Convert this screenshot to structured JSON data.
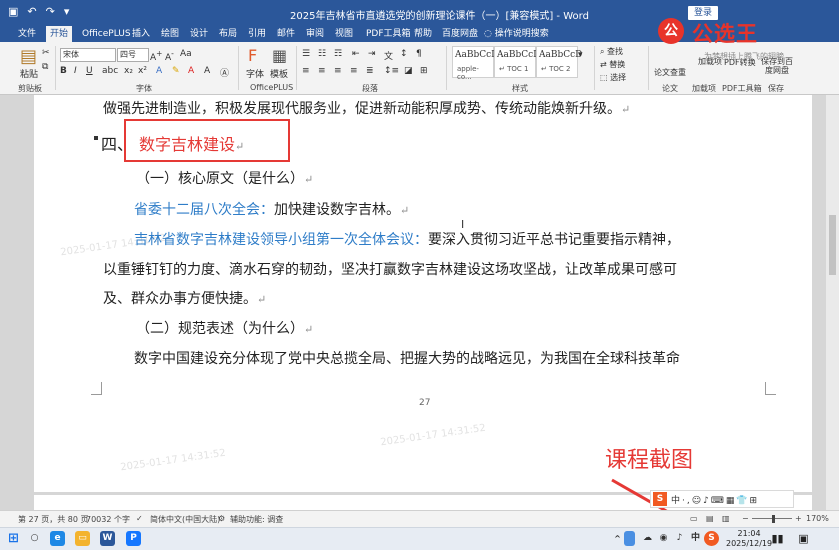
{
  "window": {
    "title": "2025年吉林省市直遴选党的创新理论课件（一）[兼容模式] - Word",
    "login_label": "登录"
  },
  "tabs": [
    "文件",
    "开始",
    "OfficePLUS",
    "插入",
    "绘图",
    "设计",
    "布局",
    "引用",
    "邮件",
    "审阅",
    "视图",
    "PDF工具箱",
    "帮助",
    "百度网盘",
    "操作说明搜索"
  ],
  "ribbon": {
    "paste_label": "粘贴",
    "font_name": "宋体",
    "font_size": "四号",
    "font_btn_label": "字体",
    "template_btn_label": "模板",
    "styles": [
      {
        "sample": "AaBbCcI",
        "name": "apple-co..."
      },
      {
        "sample": "AaBbCcD",
        "name": "↵ TOC 1"
      },
      {
        "sample": "AaBbCcD",
        "name": "↵ TOC 2"
      }
    ],
    "find_label": "查找",
    "replace_label": "替换",
    "select_label": "选择",
    "paper_check_label": "论文查重",
    "addin_label": "加载项",
    "pdf_convert_label": "PDF转换",
    "save_baidu_label": "保存到百度网盘",
    "groups": [
      "剪贴板",
      "字体",
      "OfficePLUS",
      "段落",
      "样式",
      "论文",
      "加载项",
      "PDF工具箱",
      "保存"
    ]
  },
  "logo": {
    "brand": "公选王",
    "slogan": "为梦想插上腾飞的翅膀"
  },
  "document": {
    "line_intro": "做强先进制造业，积极发展现代服务业，促进新动能积厚成势、传统动能焕新升级。",
    "heading_num": "四、",
    "heading": "数字吉林建设",
    "sub1": "（一）核心原文（是什么）",
    "p1_label": "省委十二届八次全会：",
    "p1_text": "加快建设数字吉林。",
    "p2_label": "吉林省数字吉林建设领导小组第一次全体会议：",
    "p2_text_1": "要深入贯彻习近平总书记重要指示精神，",
    "p2_text_2": "以重锤钉钉的力度、滴水石穿的韧劲，坚决打赢数字吉林建设这场攻坚战，让改革成果可感可",
    "p2_text_3": "及、群众办事方便快捷。",
    "sub2": "（二）规范表述（为什么）",
    "p3": "数字中国建设充分体现了党中央总揽全局、把握大势的战略远见，为我国在全球科技革命",
    "page_number": "27",
    "para_mark": "↵"
  },
  "watermarks": [
    "2025-01-17 14:31:52",
    "2025-01-17 14:31:52",
    "2025-01-17 14:31:52"
  ],
  "annotation": "课程截图",
  "statusbar": {
    "page": "第 27 页，共 80 页",
    "words": "70032 个字",
    "language": "简体中文(中国大陆)",
    "accessibility": "辅助功能: 调查",
    "zoom": "170%"
  },
  "taskbar": {
    "time": "21:04",
    "date": "2025/12/19"
  },
  "colors": {
    "word_blue": "#2b579a",
    "heading_red": "#e53935",
    "label_blue": "#2f7dc8"
  }
}
